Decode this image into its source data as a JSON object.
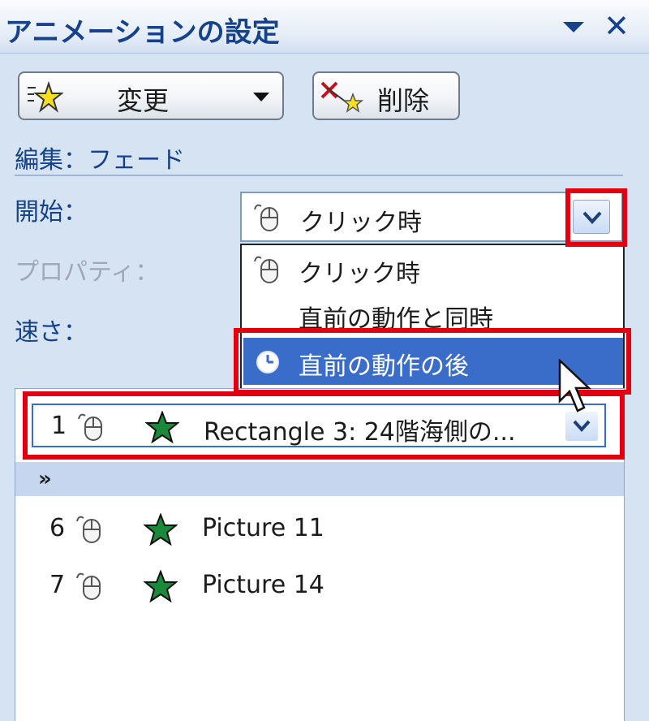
{
  "title": "アニメーションの設定",
  "toolbar": {
    "change_label": "変更",
    "delete_label": "削除"
  },
  "section": {
    "edit_label": "編集：フェード"
  },
  "fields": {
    "start_label": "開始：",
    "property_label": "プロパティ：",
    "speed_label": "速さ：",
    "start_value": "クリック時"
  },
  "start_options": [
    {
      "label": "クリック時",
      "icon": "mouse-icon"
    },
    {
      "label": "直前の動作と同時",
      "icon": ""
    },
    {
      "label": "直前の動作の後",
      "icon": "clock-icon",
      "selected": true
    }
  ],
  "animation_list": {
    "items": [
      {
        "number": "1",
        "name": "Rectangle 3: 24階海側の...",
        "trigger": "mouse-icon",
        "effect": "star-icon",
        "selected": true
      },
      {
        "number": "6",
        "name": "Picture 11",
        "trigger": "mouse-icon",
        "effect": "star-icon"
      },
      {
        "number": "7",
        "name": "Picture 14",
        "trigger": "mouse-icon",
        "effect": "star-icon"
      }
    ],
    "expand_icon": "double-chevron-down-icon"
  },
  "colors": {
    "highlight": "#e00012",
    "selected_option": "#3a6cc9",
    "label_blue": "#15428b",
    "effect_star": "#1a8a3a"
  }
}
